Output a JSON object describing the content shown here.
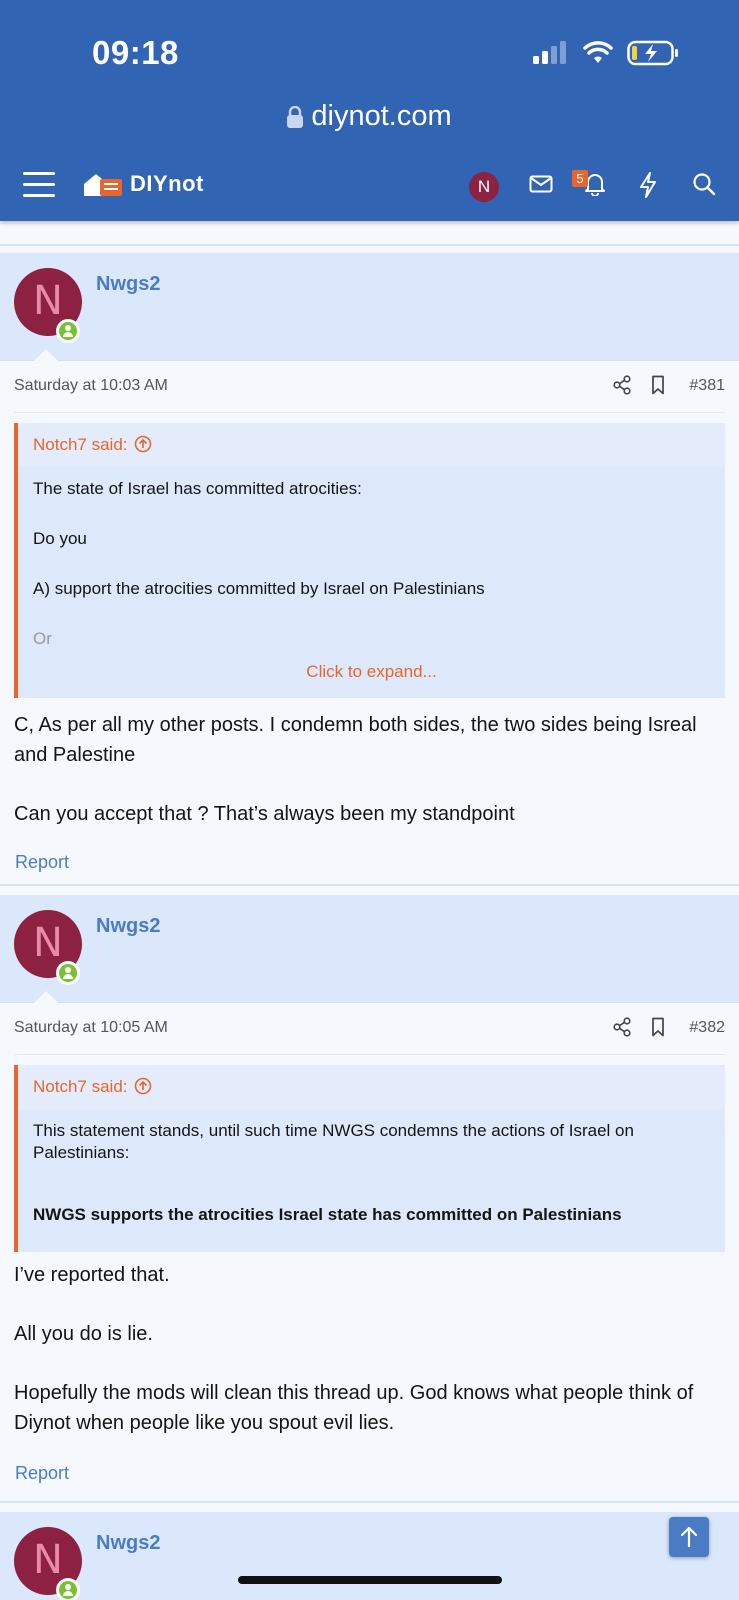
{
  "status_bar": {
    "time": "09:18"
  },
  "browser": {
    "url": "diynot.com"
  },
  "nav": {
    "logo_text": "DIYnot",
    "avatar_letter": "N",
    "alerts_count": "5",
    "icons": [
      "menu-icon",
      "logo-house-icon",
      "mail-icon",
      "bell-icon",
      "lightning-icon",
      "search-icon"
    ]
  },
  "posts": [
    {
      "avatar_letter": "N",
      "username": "Nwgs2",
      "date": "Saturday at 10:03 AM",
      "number": "#381",
      "quote": {
        "author": "Notch7 said:",
        "lines": [
          "The state of Israel has committed atrocities:",
          "Do you",
          "A) support the atrocities committed by Israel on Palestinians",
          "Or"
        ],
        "expand_label": "Click to expand..."
      },
      "message": [
        "C, As per all my other posts. I condemn both sides, the two sides being Isreal and Palestine",
        "Can you accept that ? That’s always been my standpoint"
      ],
      "report_label": "Report"
    },
    {
      "avatar_letter": "N",
      "username": "Nwgs2",
      "date": "Saturday at 10:05 AM",
      "number": "#382",
      "quote": {
        "author": "Notch7 said:",
        "lines": [
          "This statement stands, until such time NWGS condemns the actions of Israel on Palestinians:",
          "NWGS supports the atrocities Israel state has committed on Palestinians"
        ]
      },
      "message": [
        "I’ve reported that.",
        "All you do is lie.",
        "Hopefully the mods will clean this thread up. God knows what people think of Diynot when people like you spout evil lies."
      ],
      "report_label": "Report"
    },
    {
      "avatar_letter": "N",
      "username": "Nwgs2"
    }
  ],
  "colors": {
    "header_blue": "#3264b4",
    "post_head_bg": "#dbe8fb",
    "accent_orange": "#e8652c",
    "link_blue": "#4a7cc6",
    "avatar_maroon": "#8c2141",
    "online_green": "#7bbf34"
  }
}
